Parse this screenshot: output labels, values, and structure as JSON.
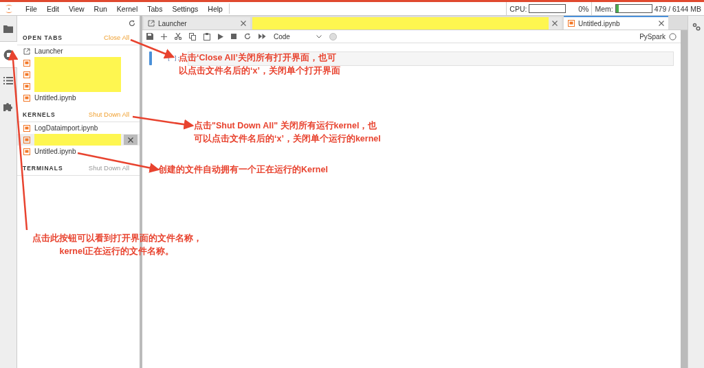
{
  "menu": [
    "File",
    "Edit",
    "View",
    "Run",
    "Kernel",
    "Tabs",
    "Settings",
    "Help"
  ],
  "status": {
    "cpu": {
      "label": "CPU:",
      "level": 0,
      "reading": "0%"
    },
    "mem": {
      "label": "Mem:",
      "level": 0.08,
      "reading": "479 / 6144 MB"
    }
  },
  "activity_bar": [
    {
      "kind": "folder",
      "selected": false
    },
    {
      "kind": "running",
      "selected": true
    },
    {
      "kind": "toc",
      "selected": false
    },
    {
      "kind": "extensions",
      "selected": false
    }
  ],
  "sidebar": {
    "sections": [
      {
        "title": "OPEN TABS",
        "action": "Close All",
        "action_enabled": true,
        "items": [
          {
            "kind": "launcher",
            "label": "Launcher",
            "redacted": false,
            "hovered": false
          },
          {
            "kind": "notebook",
            "redacted": true,
            "hovered": false
          },
          {
            "kind": "notebook",
            "redacted": true,
            "hovered": false
          },
          {
            "kind": "notebook",
            "redacted": true,
            "hovered": false
          },
          {
            "kind": "notebook",
            "label": "Untitled.ipynb",
            "redacted": false,
            "hovered": false
          }
        ]
      },
      {
        "title": "KERNELS",
        "action": "Shut Down All",
        "action_enabled": true,
        "items": [
          {
            "kind": "notebook",
            "label": "LogDataimport.ipynb",
            "redacted": false,
            "hovered": false
          },
          {
            "kind": "notebook",
            "redacted": true,
            "hovered": true
          },
          {
            "kind": "notebook",
            "label": "Untitled.ipynb",
            "redacted": false,
            "hovered": false
          }
        ]
      },
      {
        "title": "TERMINALS",
        "action": "Shut Down All",
        "action_enabled": false
      }
    ]
  },
  "tabs": [
    {
      "kind": "launcher",
      "label": "Launcher",
      "redacted": false,
      "selected": false
    },
    {
      "redacted": true,
      "selected": false
    },
    {
      "kind": "notebook",
      "label": "Untitled.ipynb",
      "redacted": false,
      "selected": true
    }
  ],
  "toolbar": {
    "cell_type": "Code",
    "kernel_name": "PySpark",
    "kernel_busy": false
  },
  "cells": [
    {
      "prompt": "[ ]:"
    }
  ],
  "annotations": [
    {
      "lines": [
        "点击‘Close All’关闭所有打开界面，也可",
        "以点击文件名后的‘x’，关闭单个打开界面"
      ]
    },
    {
      "lines": [
        "点击\"Shut Down All\" 关闭所有运行kernel，也",
        "可以点击文件名后的‘x’，关闭单个运行的kernel"
      ]
    },
    {
      "lines": [
        "创建的文件自动拥有一个正在运行的Kernel"
      ]
    },
    {
      "lines": [
        "点击此按钮可以看到打开界面的文件名称，",
        "kernel正在运行的文件名称。"
      ]
    }
  ]
}
